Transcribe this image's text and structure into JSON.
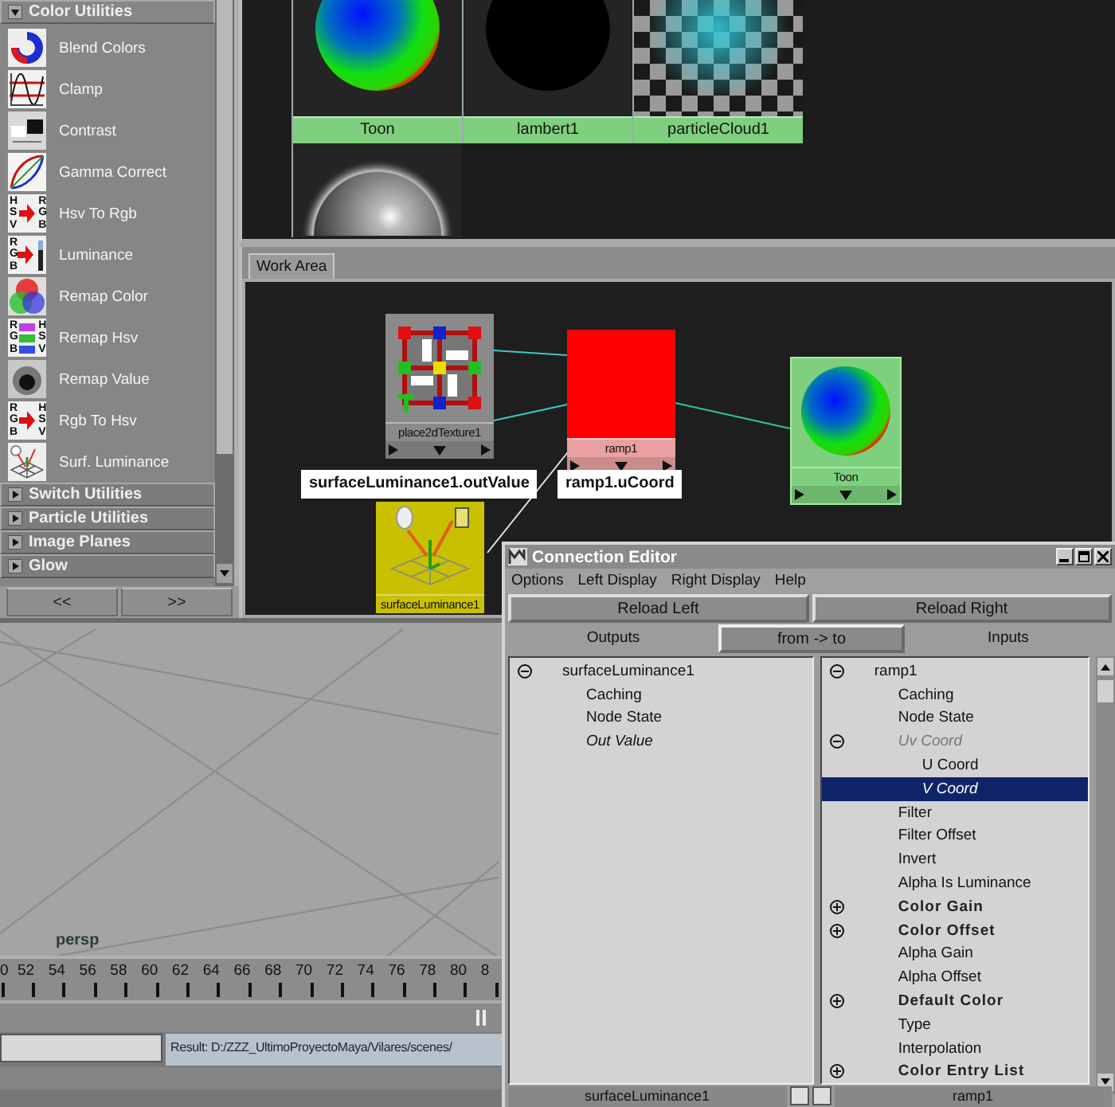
{
  "utilities_panel": {
    "sections": [
      {
        "label": "Color Utilities",
        "expanded": true,
        "items": [
          {
            "label": "Blend Colors",
            "kind": "blend"
          },
          {
            "label": "Clamp",
            "kind": "clamp"
          },
          {
            "label": "Contrast",
            "kind": "contrast"
          },
          {
            "label": "Gamma Correct",
            "kind": "gamma"
          },
          {
            "label": "Hsv To Rgb",
            "kind": "convert",
            "icon_letters": [
              "HSV",
              "RGB"
            ]
          },
          {
            "label": "Luminance",
            "kind": "luminance",
            "icon_letters": [
              "RGB"
            ]
          },
          {
            "label": "Remap Color",
            "kind": "remap-color"
          },
          {
            "label": "Remap Hsv",
            "kind": "remap-hsv",
            "icon_letters": [
              "RGB",
              "HSV"
            ]
          },
          {
            "label": "Remap Value",
            "kind": "remap-value"
          },
          {
            "label": "Rgb To Hsv",
            "kind": "convert",
            "icon_letters": [
              "RGB",
              "HSV"
            ]
          },
          {
            "label": "Surf. Luminance",
            "kind": "surf-luminance"
          }
        ]
      },
      {
        "label": "Switch Utilities",
        "expanded": false
      },
      {
        "label": "Particle Utilities",
        "expanded": false
      },
      {
        "label": "Image Planes",
        "expanded": false
      },
      {
        "label": "Glow",
        "expanded": false
      }
    ],
    "nav_buttons": [
      "<<",
      ">>"
    ]
  },
  "swatches": [
    {
      "label": "Toon",
      "kind": "toon"
    },
    {
      "label": "lambert1",
      "kind": "lambert"
    },
    {
      "label": "particleCloud1",
      "kind": "cloud"
    },
    {
      "kind": "chrome"
    }
  ],
  "work_area": {
    "tab": "Work Area",
    "nodes": [
      {
        "label": "place2dTexture1",
        "kind": "place2d"
      },
      {
        "label": "ramp1",
        "kind": "ramp"
      },
      {
        "label": "Toon",
        "kind": "toon"
      },
      {
        "label": "surfaceLuminance1",
        "kind": "surf-luminance"
      }
    ],
    "tooltips": [
      "surfaceLuminance1.outValue",
      "ramp1.uCoord"
    ]
  },
  "viewport": {
    "camera": "persp"
  },
  "timeline": {
    "ticks": [
      "0",
      "52",
      "54",
      "56",
      "58",
      "60",
      "62",
      "64",
      "66",
      "68",
      "70",
      "72",
      "74",
      "76",
      "78",
      "80",
      "8"
    ]
  },
  "command_line": {
    "result": "Result: D:/ZZZ_UltimoProyectoMaya/Vilares/scenes/"
  },
  "connection_editor": {
    "title": "Connection Editor",
    "menu": [
      "Options",
      "Left Display",
      "Right Display",
      "Help"
    ],
    "reload": [
      "Reload Left",
      "Reload Right"
    ],
    "outputs": "Outputs",
    "direction": "from -> to",
    "inputs": "Inputs",
    "left_list": [
      {
        "label": "surfaceLuminance1",
        "expanded": true,
        "connected": false,
        "selected": false,
        "children": [
          {
            "label": "Caching",
            "connected": false,
            "selected": false
          },
          {
            "label": "Node State",
            "connected": false,
            "selected": false
          },
          {
            "label": "Out Value",
            "connected": true,
            "selected": false
          }
        ]
      }
    ],
    "right_list": [
      {
        "label": "ramp1",
        "expanded": true,
        "connected": false,
        "selected": false,
        "children": [
          {
            "label": "Caching",
            "connected": false,
            "selected": false
          },
          {
            "label": "Node State",
            "connected": false,
            "selected": false
          },
          {
            "label": "Uv Coord",
            "expanded": true,
            "connected": true,
            "selected": false,
            "children": [
              {
                "label": "U Coord",
                "connected": false,
                "selected": false
              },
              {
                "label": "V Coord",
                "connected": true,
                "selected": true
              }
            ]
          },
          {
            "label": "Filter",
            "connected": false,
            "selected": false
          },
          {
            "label": "Filter Offset",
            "connected": false,
            "selected": false
          },
          {
            "label": "Invert",
            "connected": false,
            "selected": false
          },
          {
            "label": "Alpha Is Luminance",
            "connected": false,
            "selected": false
          },
          {
            "label": "Color Gain",
            "expanded": false,
            "connected": false,
            "selected": false
          },
          {
            "label": "Color Offset",
            "expanded": false,
            "connected": false,
            "selected": false
          },
          {
            "label": "Alpha Gain",
            "connected": false,
            "selected": false
          },
          {
            "label": "Alpha Offset",
            "connected": false,
            "selected": false
          },
          {
            "label": "Default Color",
            "expanded": false,
            "connected": false,
            "selected": false
          },
          {
            "label": "Type",
            "connected": false,
            "selected": false
          },
          {
            "label": "Interpolation",
            "connected": false,
            "selected": false
          },
          {
            "label": "Color Entry List",
            "expanded": false,
            "connected": false,
            "selected": false
          }
        ]
      }
    ],
    "left_footer": "surfaceLuminance1",
    "right_footer": "ramp1"
  }
}
